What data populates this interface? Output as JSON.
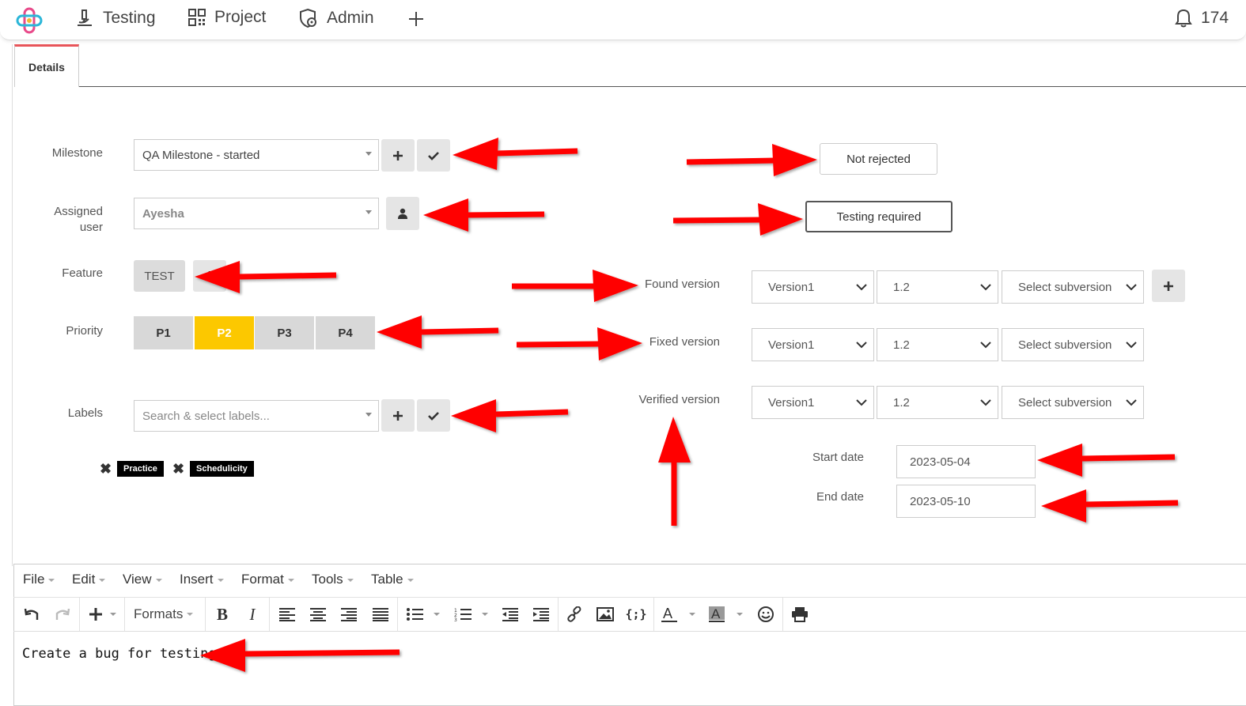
{
  "nav": {
    "items": [
      {
        "label": "Testing",
        "icon": "microscope-icon"
      },
      {
        "label": "Project",
        "icon": "qr-grid-icon"
      },
      {
        "label": "Admin",
        "icon": "shield-gear-icon"
      }
    ],
    "notifications_count": "174"
  },
  "tabs": [
    {
      "label": "Details",
      "active": true
    }
  ],
  "form": {
    "milestone": {
      "label": "Milestone",
      "value": "QA Milestone - started"
    },
    "assigned_user": {
      "label_line1": "Assigned",
      "label_line2": "user",
      "value": "Ayesha"
    },
    "feature": {
      "label": "Feature",
      "value": "TEST"
    },
    "priority": {
      "label": "Priority",
      "options": [
        "P1",
        "P2",
        "P3",
        "P4"
      ],
      "selected": "P2"
    },
    "labels": {
      "label": "Labels",
      "placeholder": "Search & select labels...",
      "tags": [
        "Practice",
        "Schedulicity"
      ]
    }
  },
  "status": {
    "rejected": "Not rejected",
    "testing": "Testing required"
  },
  "versions": {
    "found": {
      "label": "Found version",
      "version": "Version1",
      "release": "1.2",
      "subversion": "Select subversion"
    },
    "fixed": {
      "label": "Fixed version",
      "version": "Version1",
      "release": "1.2",
      "subversion": "Select subversion"
    },
    "verified": {
      "label": "Verified version",
      "version": "Version1",
      "release": "1.2",
      "subversion": "Select subversion"
    }
  },
  "dates": {
    "start": {
      "label": "Start date",
      "value": "2023-05-04"
    },
    "end": {
      "label": "End date",
      "value": "2023-05-10"
    }
  },
  "editor": {
    "menus": [
      "File",
      "Edit",
      "View",
      "Insert",
      "Format",
      "Tools",
      "Table"
    ],
    "formats_label": "Formats",
    "content": "Create a bug for testing."
  },
  "colors": {
    "accent": "#fcc800",
    "tab_accent": "#e8555a",
    "annotation_arrow": "#ff0000"
  }
}
